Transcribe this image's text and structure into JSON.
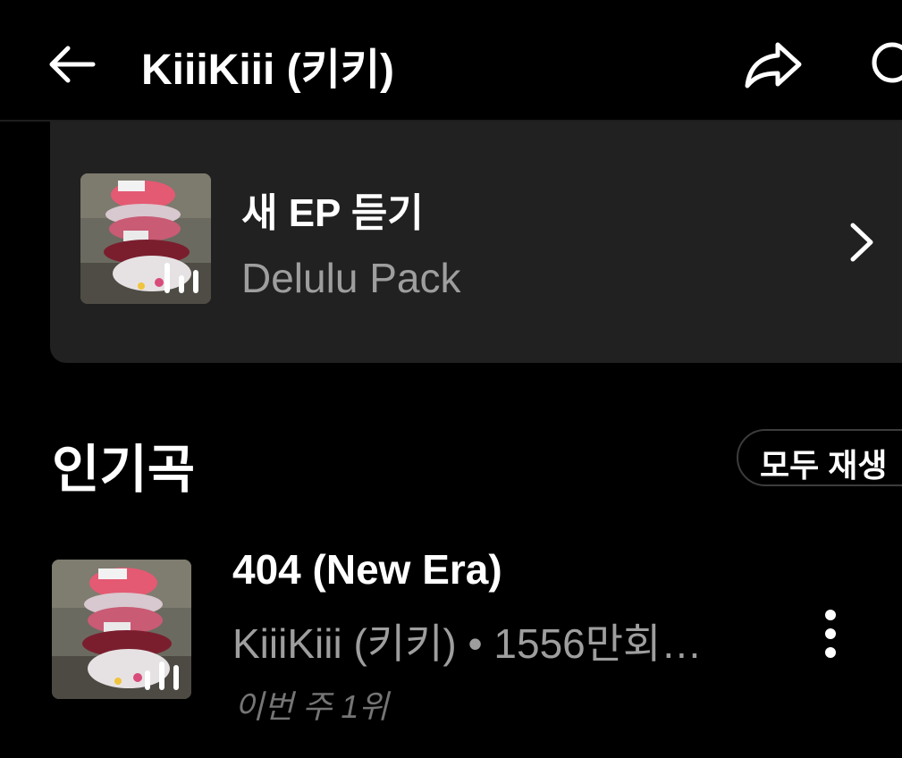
{
  "header": {
    "title": "KiiiKiii (키키)",
    "back_icon": "arrow-left-icon",
    "share_icon": "share-arrow-icon",
    "search_icon": "search-icon"
  },
  "new_release": {
    "kicker": "새 EP 듣기",
    "title": "Delulu Pack",
    "status_icon": "equalizer-playing-icon",
    "chevron_icon": "chevron-right-icon"
  },
  "popular": {
    "heading": "인기곡",
    "play_all_label": "모두 재생",
    "songs": [
      {
        "title": "404 (New Era)",
        "meta": "KiiiKiii (키키) • 1556만회…",
        "rank_note": "이번 주 1위",
        "status_icon": "equalizer-playing-icon",
        "menu_icon": "more-vertical-icon"
      }
    ]
  },
  "colors": {
    "background": "#000000",
    "card": "#212121",
    "secondary_text": "#9e9e9e",
    "tertiary_text": "#757575",
    "accent_pink": "#e8405f"
  }
}
